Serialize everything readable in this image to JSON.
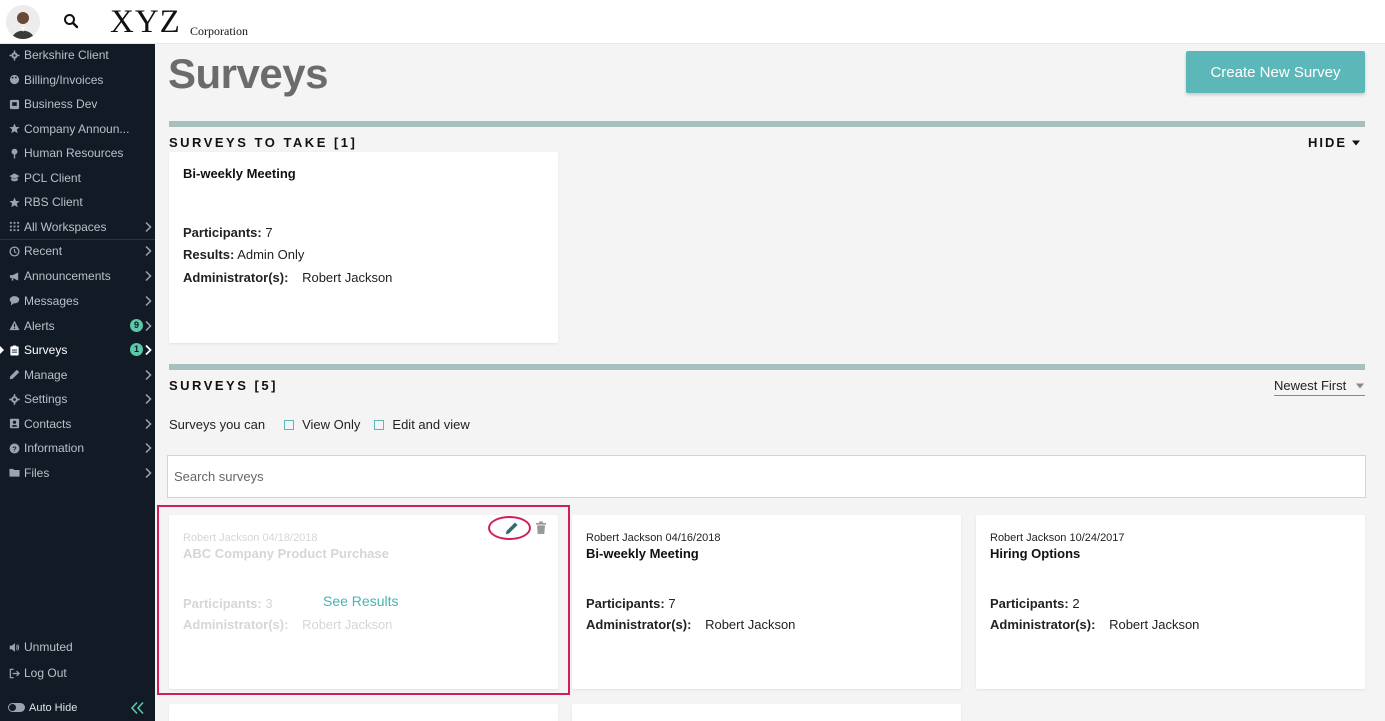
{
  "header": {
    "logo_main": "XYZ",
    "logo_sub": "Corporation"
  },
  "sidebar": {
    "workspaces": [
      {
        "label": "Berkshire Client",
        "icon": "gear-icon"
      },
      {
        "label": "Billing/Invoices",
        "icon": "palette-icon"
      },
      {
        "label": "Business Dev",
        "icon": "briefcase-icon"
      },
      {
        "label": "Company Announ...",
        "icon": "star-icon"
      },
      {
        "label": "Human Resources",
        "icon": "pin-icon"
      },
      {
        "label": "PCL Client",
        "icon": "graduation-cap-icon"
      },
      {
        "label": "RBS Client",
        "icon": "star-icon"
      },
      {
        "label": "All Workspaces",
        "icon": "grid-icon"
      }
    ],
    "nav": [
      {
        "label": "Recent",
        "icon": "history-icon"
      },
      {
        "label": "Announcements",
        "icon": "megaphone-icon"
      },
      {
        "label": "Messages",
        "icon": "chat-icon"
      },
      {
        "label": "Alerts",
        "icon": "warning-icon",
        "badge": "9"
      },
      {
        "label": "Surveys",
        "icon": "clipboard-icon",
        "badge": "1"
      },
      {
        "label": "Manage",
        "icon": "pencil-icon"
      },
      {
        "label": "Settings",
        "icon": "cog-icon"
      },
      {
        "label": "Contacts",
        "icon": "address-book-icon"
      },
      {
        "label": "Information",
        "icon": "question-icon"
      },
      {
        "label": "Files",
        "icon": "folder-icon"
      }
    ],
    "footer": {
      "unmuted": "Unmuted",
      "logout": "Log Out",
      "auto_hide": "Auto Hide"
    }
  },
  "main": {
    "title": "Surveys",
    "create_button": "Create New Survey",
    "to_take": {
      "heading": "SURVEYS TO TAKE [1]",
      "hide_label": "HIDE",
      "card": {
        "title": "Bi-weekly Meeting",
        "participants_label": "Participants:",
        "participants_value": "7",
        "results_label": "Results:",
        "results_value": "Admin Only",
        "admin_label": "Administrator(s):",
        "admin_value": "Robert Jackson"
      }
    },
    "surveys": {
      "heading": "SURVEYS [5]",
      "sort_value": "Newest First",
      "filter_label": "Surveys you can",
      "filter_view_only": "View Only",
      "filter_edit_view": "Edit and view",
      "search_placeholder": "Search surveys",
      "see_results": "See Results",
      "participants_label": "Participants:",
      "admin_label": "Administrator(s):",
      "cards": [
        {
          "meta": "Robert Jackson 04/18/2018",
          "title": "ABC Company Product Purchase",
          "participants": "3",
          "admin": "Robert Jackson"
        },
        {
          "meta": "Robert Jackson 04/16/2018",
          "title": "Bi-weekly Meeting",
          "participants": "7",
          "admin": "Robert Jackson"
        },
        {
          "meta": "Robert Jackson 10/24/2017",
          "title": "Hiring Options",
          "participants": "2",
          "admin": "Robert Jackson"
        }
      ]
    }
  },
  "colors": {
    "sidebar_bg": "#121a26",
    "accent_teal": "#5cb8b8",
    "badge_green": "#5cc6a8",
    "highlight": "#d11d5c"
  }
}
